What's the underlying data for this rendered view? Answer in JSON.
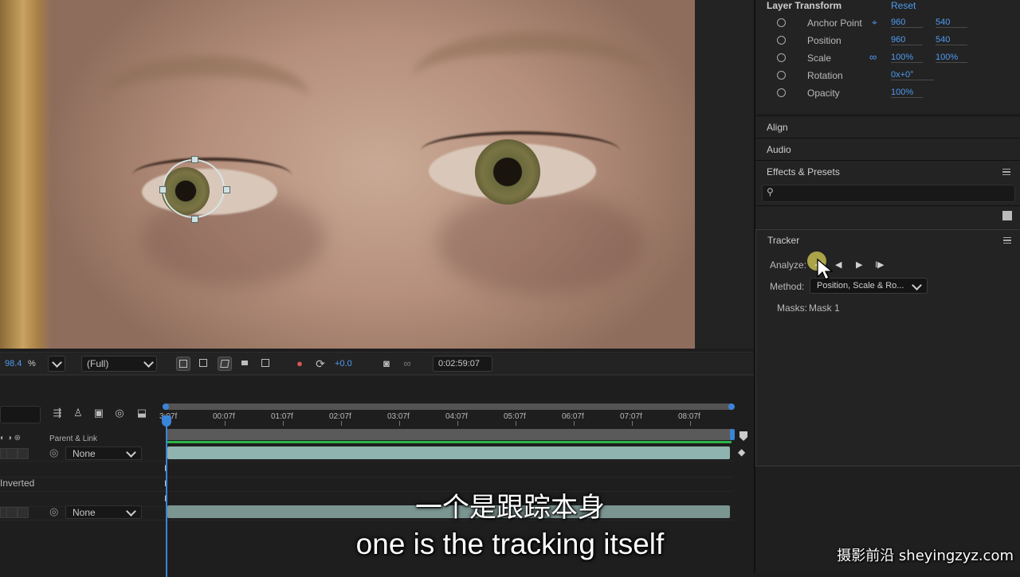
{
  "viewer": {
    "zoom_value": "98.4",
    "zoom_unit": "%",
    "resolution": "(Full)",
    "exposure": "+0.0",
    "timecode": "0:02:59:07"
  },
  "timeline": {
    "ruler_ticks": [
      "3:07f",
      "00:07f",
      "01:07f",
      "02:07f",
      "03:07f",
      "04:07f",
      "05:07f",
      "06:07f",
      "07:07f",
      "08:07f"
    ],
    "column_header": "Parent & Link",
    "layer1_parent": "None",
    "mask_mode": "Inverted",
    "layer2_parent": "None"
  },
  "layer_transform": {
    "title": "Layer Transform",
    "reset": "Reset",
    "properties": [
      {
        "label": "Anchor Point",
        "v1": "960",
        "v2": "540"
      },
      {
        "label": "Position",
        "v1": "960",
        "v2": "540"
      },
      {
        "label": "Scale",
        "v1": "100%",
        "v2": "100%"
      },
      {
        "label": "Rotation",
        "v1": "0x+0°"
      },
      {
        "label": "Opacity",
        "v1": "100%"
      }
    ]
  },
  "panels": {
    "align": "Align",
    "audio": "Audio",
    "effects": "Effects & Presets",
    "tracker": "Tracker"
  },
  "tracker": {
    "analyze_label": "Analyze:",
    "method_label": "Method:",
    "method_value": "Position, Scale & Ro...",
    "masks_label": "Masks:",
    "masks_value": "Mask 1"
  },
  "subtitles": {
    "chinese": "一个是跟踪本身",
    "english": "one is the tracking itself"
  },
  "watermark": "摄影前沿 sheyingzyz.com",
  "colors": {
    "accent": "#3a84d8",
    "value_blue": "#4f9bf0",
    "layer_bar": "#8fb3ae",
    "work_area_green": "#2bb54a"
  }
}
